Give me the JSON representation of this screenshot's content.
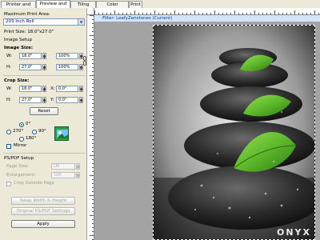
{
  "tabs": [
    {
      "label": "Printer and Media",
      "active": false
    },
    {
      "label": "Preview and Size",
      "active": true
    },
    {
      "label": "Tiling Setup",
      "active": false
    },
    {
      "label": "Color Correction",
      "active": false
    },
    {
      "label": "Print",
      "active": false
    }
  ],
  "panel": {
    "print_area_label": "Maximum Print Area:",
    "print_area_value": "203 Inch Roll",
    "print_size": "Print Size: 18.0\"x27.0\"",
    "image_setup": "Image Setup",
    "image_size": {
      "heading": "Image Size:",
      "w_label": "W:",
      "w_value": "18.0\"",
      "w_pct": "100%",
      "h_label": "H:",
      "h_value": "27.0\"",
      "h_pct": "100%"
    },
    "crop_size": {
      "heading": "Crop Size:",
      "w_label": "W:",
      "w_value": "18.0\"",
      "x_label": "X:",
      "x_value": "0.0\"",
      "h_label": "H:",
      "h_value": "27.0\"",
      "y_label": "Y:",
      "y_value": "0.0\""
    },
    "reset_label": "Reset",
    "rotation": {
      "deg0": "0°",
      "deg270": "270°",
      "deg90": "90°",
      "deg180": "180°",
      "selected": "0°"
    },
    "mirror_label": "Mirror",
    "ps_pdf": {
      "heading": "PS/PDF Setup",
      "page_size_label": "Page Size:",
      "page_size_value": "LM",
      "enlargement_label": "Enlargement:",
      "enlargement_value": "100",
      "crop_outside_label": "Crop Outside Page"
    },
    "swap_label": "Swap Width & Height",
    "original_label": "Original PS/PDF Settings",
    "apply_label": "Apply"
  },
  "canvas": {
    "filter_text": "Filter: LeafyZenstones (Current)",
    "logo_text": "ONYX"
  },
  "colors": {
    "accent": "#003a9e",
    "leaf": "#5db82a",
    "canvas_bg": "#a3a3a3"
  }
}
